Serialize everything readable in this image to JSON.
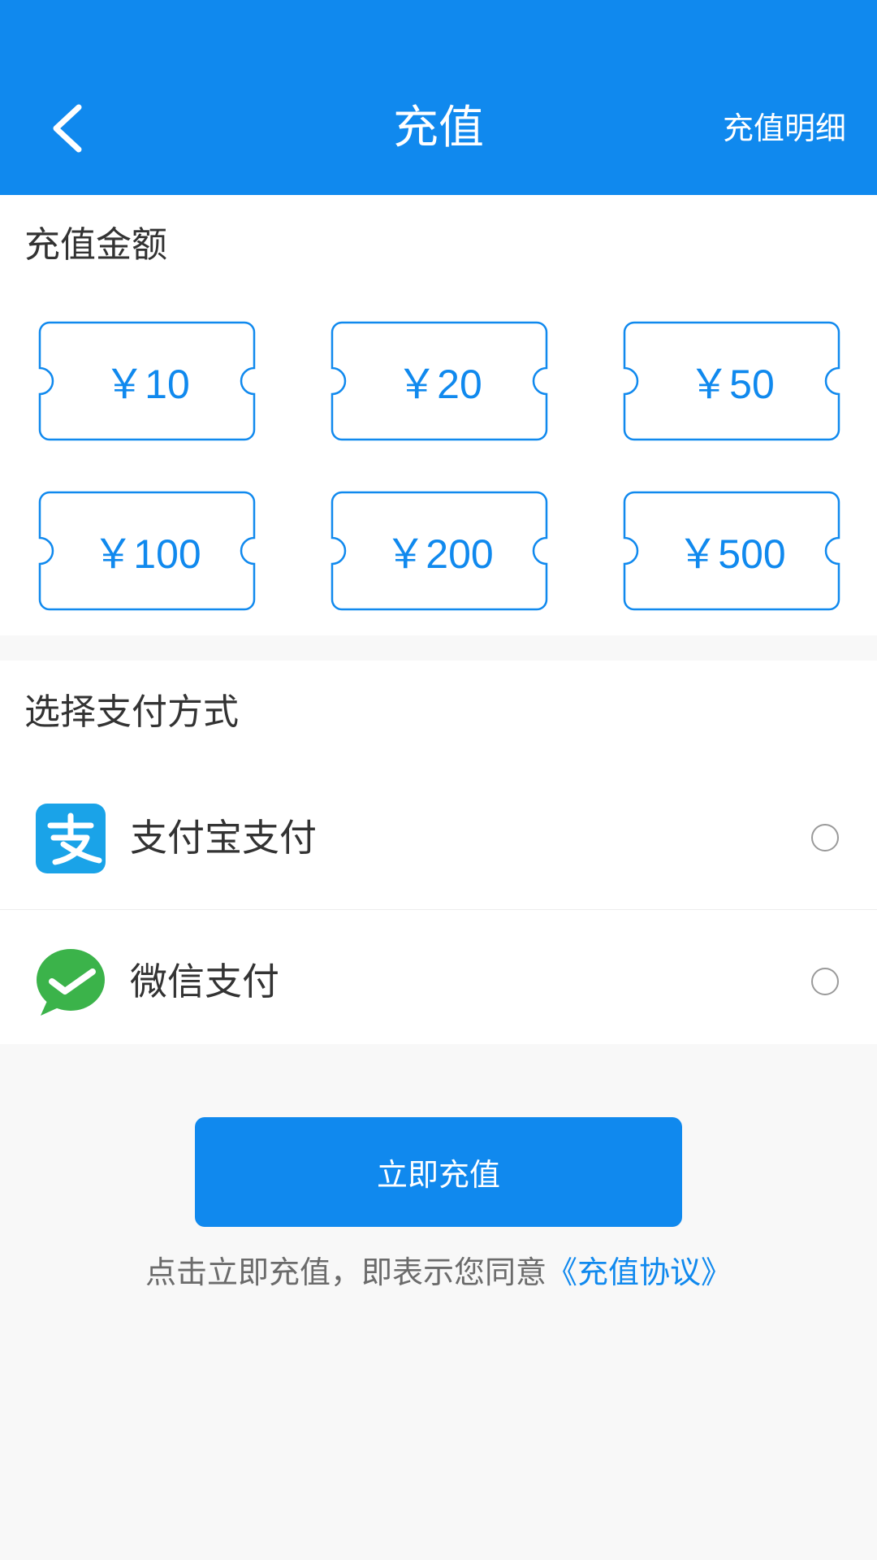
{
  "header": {
    "title": "充值",
    "detail_link": "充值明细",
    "back_icon": "chevron-left-icon",
    "background_color": "#1089ee"
  },
  "amount_section": {
    "title": "充值金额",
    "options": [
      {
        "label": "￥10"
      },
      {
        "label": "￥20"
      },
      {
        "label": "￥50"
      },
      {
        "label": "￥100"
      },
      {
        "label": "￥200"
      },
      {
        "label": "￥500"
      }
    ]
  },
  "payment_section": {
    "title": "选择支付方式",
    "methods": [
      {
        "label": "支付宝支付",
        "icon": "alipay-icon",
        "selected": false
      },
      {
        "label": "微信支付",
        "icon": "wechat-pay-icon",
        "selected": false
      }
    ]
  },
  "submit": {
    "label": "立即充值"
  },
  "agreement": {
    "text": "点击立即充值，即表示您同意",
    "link": "《充值协议》"
  },
  "colors": {
    "accent": "#1089ee",
    "alipay": "#1aa3e8",
    "wechat": "#3bb34a"
  }
}
